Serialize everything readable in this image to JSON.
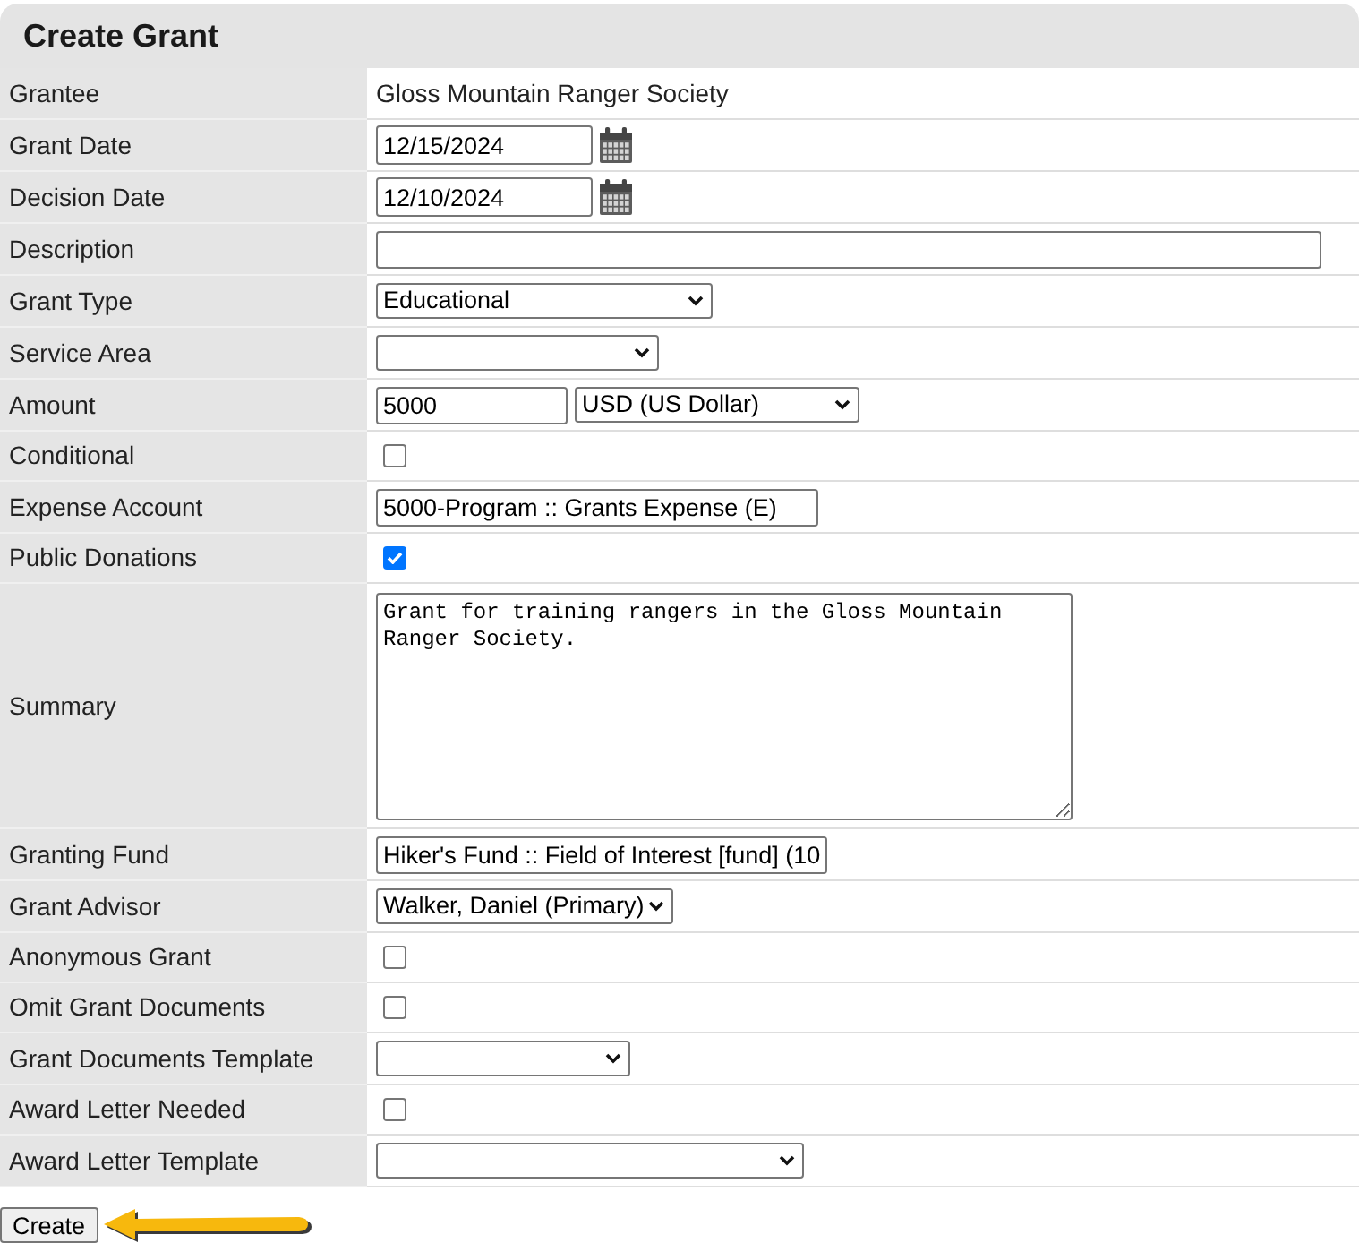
{
  "title": "Create Grant",
  "fields": [
    {
      "label": "Grantee",
      "kind": "text",
      "value": "Gloss Mountain Ranger Society"
    },
    {
      "label": "Grant Date",
      "kind": "date",
      "value": "12/15/2024"
    },
    {
      "label": "Decision Date",
      "kind": "date",
      "value": "12/10/2024"
    },
    {
      "label": "Description",
      "kind": "input"
    },
    {
      "label": "Grant Type",
      "kind": "select",
      "value": "Educational"
    },
    {
      "label": "Service Area",
      "kind": "select"
    },
    {
      "label": "Amount",
      "kind": "amount",
      "value": "5000",
      "currency": "USD (US Dollar)"
    },
    {
      "label": "Conditional",
      "kind": "checkbox",
      "checked": false
    },
    {
      "label": "Expense Account",
      "kind": "input",
      "value": "5000-Program :: Grants Expense (E)"
    },
    {
      "label": "Public Donations",
      "kind": "checkbox",
      "checked": true
    },
    {
      "label": "Summary",
      "kind": "textarea",
      "value": "Grant for training rangers in the Gloss Mountain Ranger Society."
    },
    {
      "label": "Granting Fund",
      "kind": "input",
      "value": "Hiker's Fund :: Field of Interest [fund] (10"
    },
    {
      "label": "Grant Advisor",
      "kind": "select",
      "value": "Walker, Daniel (Primary)"
    },
    {
      "label": "Anonymous Grant",
      "kind": "checkbox",
      "checked": false
    },
    {
      "label": "Omit Grant Documents",
      "kind": "checkbox",
      "checked": false
    },
    {
      "label": "Grant Documents Template",
      "kind": "select"
    },
    {
      "label": "Award Letter Needed",
      "kind": "checkbox",
      "checked": false
    },
    {
      "label": "Award Letter Template",
      "kind": "select"
    }
  ],
  "submit_button": "Create"
}
